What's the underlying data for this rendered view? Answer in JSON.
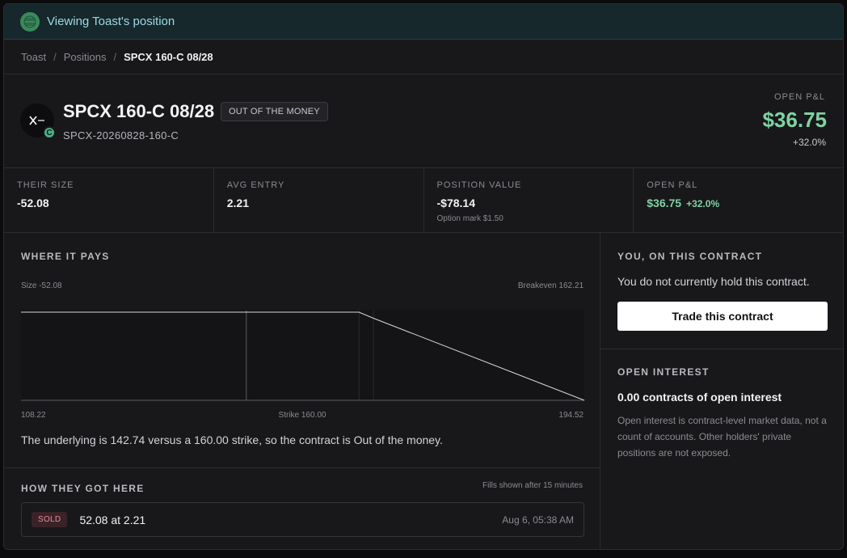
{
  "banner": {
    "text": "Viewing Toast's position"
  },
  "breadcrumb": {
    "items": [
      "Toast",
      "Positions"
    ],
    "current": "SPCX 160-C 08/28"
  },
  "header": {
    "title": "SPCX 160-C 08/28",
    "status_badge": "OUT OF THE MONEY",
    "symbol": "SPCX-20260828-160-C",
    "avatar_badge": "C",
    "open_pnl_label": "OPEN P&L",
    "open_pnl_value": "$36.75",
    "open_pnl_pct": "+32.0%"
  },
  "stats": [
    {
      "label": "THEIR SIZE",
      "value": "-52.08"
    },
    {
      "label": "AVG ENTRY",
      "value": "2.21"
    },
    {
      "label": "POSITION VALUE",
      "value": "-$78.14",
      "sub": "Option mark $1.50"
    },
    {
      "label": "OPEN P&L",
      "value": "$36.75",
      "pct": "+32.0%"
    }
  ],
  "payoff": {
    "title": "WHERE IT PAYS",
    "size_label": "Size -52.08",
    "breakeven_label": "Breakeven 162.21",
    "x_min_label": "108.22",
    "strike_label": "Strike 160.00",
    "x_max_label": "194.52",
    "caption": "The underlying is 142.74 versus a 160.00 strike, so the contract is Out of the money."
  },
  "chart_data": {
    "type": "line",
    "title": "WHERE IT PAYS",
    "x_range": [
      108.22,
      194.52
    ],
    "strike": 160.0,
    "breakeven": 162.21,
    "underlying": 142.74,
    "series": [
      {
        "x": [
          108.22,
          160.0,
          162.21,
          194.52
        ],
        "y": [
          115.08,
          115.08,
          0,
          -1567.08
        ]
      }
    ],
    "xlabels": [
      "108.22",
      "Strike 160.00",
      "194.52"
    ],
    "annotations": [
      "Size -52.08",
      "Breakeven 162.21"
    ]
  },
  "history": {
    "title": "HOW THEY GOT HERE",
    "note": "Fills shown after 15 minutes",
    "fills": [
      {
        "side": "SOLD",
        "text": "52.08 at 2.21",
        "time": "Aug 6, 05:38 AM"
      }
    ]
  },
  "you": {
    "title": "YOU, ON THIS CONTRACT",
    "text": "You do not currently hold this contract.",
    "button": "Trade this contract"
  },
  "open_interest": {
    "title": "OPEN INTEREST",
    "value": "0.00 contracts of open interest",
    "note": "Open interest is contract-level market data, not a count of accounts. Other holders' private positions are not exposed."
  },
  "colors": {
    "positive": "#7fd3a2",
    "negative": "#e48a96",
    "banner": "#16282c"
  }
}
